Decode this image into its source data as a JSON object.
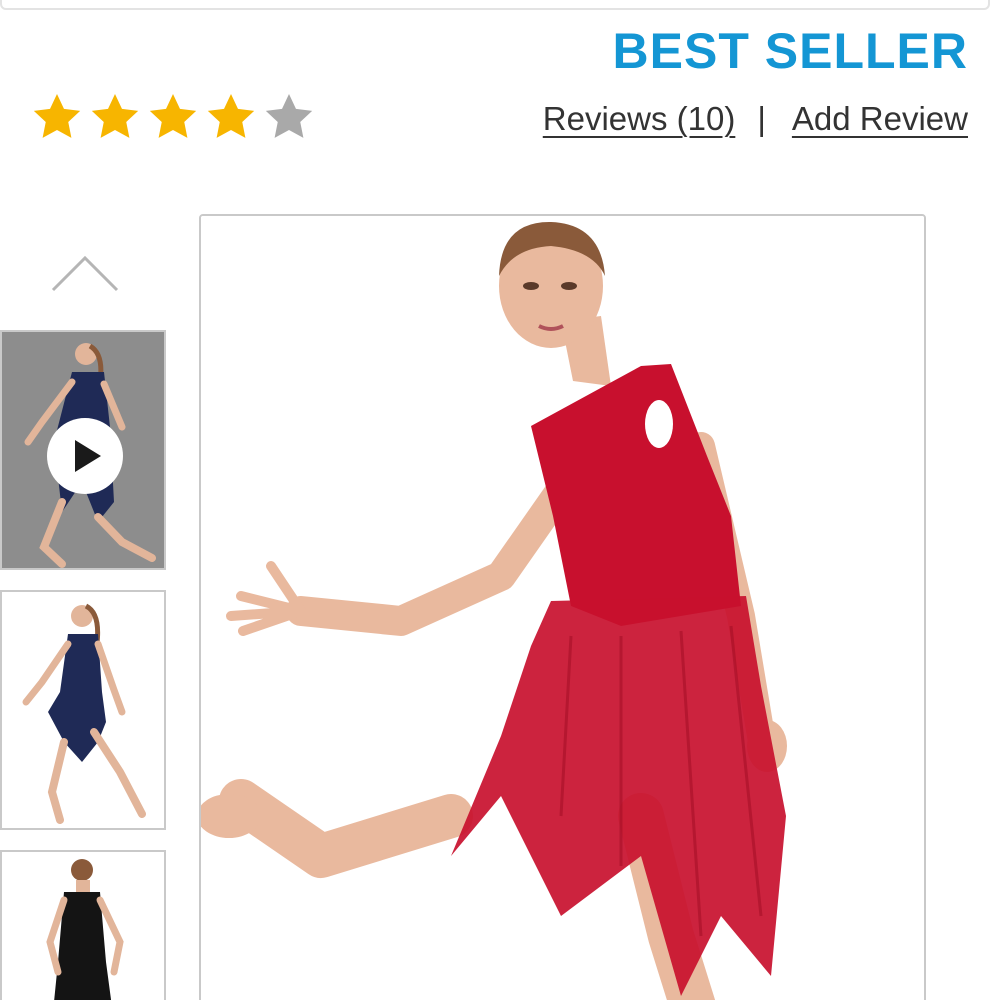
{
  "product": {
    "badge": "BEST SELLER",
    "rating": 4,
    "rating_max": 5,
    "reviews_link": "Reviews (10)",
    "separator": "|",
    "add_review_link": "Add Review"
  },
  "colors": {
    "badge": "#1496d4",
    "star_filled": "#f7b500",
    "star_empty": "#a9a9a9",
    "dress_red": "#c8102e",
    "dress_navy": "#1f2a56",
    "dress_black": "#141414"
  },
  "gallery": {
    "scroll_up_icon": "chevron-up-icon",
    "thumbnails": [
      {
        "dress_color": "navy",
        "is_video": true,
        "icon": "play-icon"
      },
      {
        "dress_color": "navy",
        "is_video": false
      },
      {
        "dress_color": "black",
        "is_video": false
      }
    ],
    "main_image": {
      "dress_color": "red"
    }
  }
}
